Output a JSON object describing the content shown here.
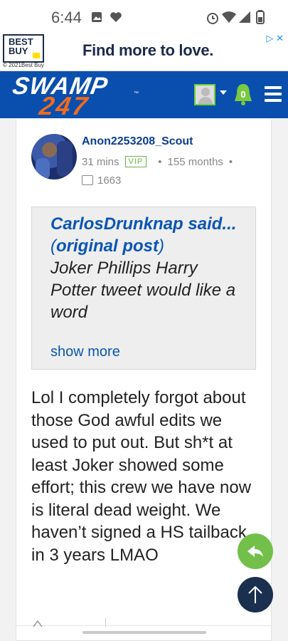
{
  "status_bar": {
    "time": "6:44"
  },
  "ad": {
    "logo_line1": "BEST",
    "logo_line2": "BUY",
    "headline": "Find more to love.",
    "copyright": "© 2021Best Buy",
    "ad_controls": "▷ ✕"
  },
  "header": {
    "brand_top": "SWAMP",
    "brand_bottom": "247",
    "notification_count": "0"
  },
  "post": {
    "username": "Anon2253208_Scout",
    "time_ago": "31 mins",
    "badge": "VIP",
    "tenure": "155 months",
    "post_count": "1663",
    "quote": {
      "author": "CarlosDrunknap said...",
      "original_link": "original post",
      "text": "Joker Phillips Harry Potter tweet would like a word",
      "show_more": "show more"
    },
    "body": "Lol I completely forgot about those God awful edits we used to put out. But sh*t at least Joker showed some effort; this crew we have now is literal dead weight. We haven’t signed a HS tailback in 3 years LMAO"
  },
  "colors": {
    "header_bg": "#0a4fae",
    "accent_orange": "#f26b1d",
    "link_blue": "#0b55b5",
    "reply_green": "#72c04a",
    "top_button": "#1b2f4e"
  }
}
